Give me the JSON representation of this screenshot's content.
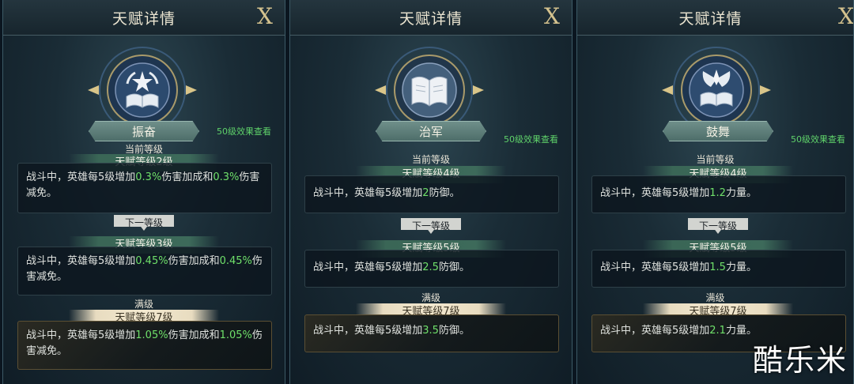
{
  "panels": [
    {
      "title": "天赋详情",
      "close": "X",
      "talent_name": "振奋",
      "effect_link": "50级效果查看",
      "current_label": "当前等级",
      "current_level": "天赋等级2级",
      "current_desc": {
        "pre": "战斗中，英雄每5级增加",
        "v1": "0.3%",
        "mid": "伤害加成和",
        "v2": "0.3%",
        "post": "伤害减免。"
      },
      "next_label": "下一等级",
      "next_level": "天赋等级3级",
      "next_desc": {
        "pre": "战斗中，英雄每5级增加",
        "v1": "0.45%",
        "mid": "伤害加成和",
        "v2": "0.45%",
        "post": "伤害减免。"
      },
      "max_label": "满级",
      "max_level": "天赋等级7级",
      "max_desc": {
        "pre": "战斗中，英雄每5级增加",
        "v1": "1.05%",
        "mid": "伤害加成和",
        "v2": "1.05%",
        "post": "伤害减免。"
      }
    },
    {
      "title": "天赋详情",
      "close": "X",
      "talent_name": "治军",
      "effect_link": "50级效果查看",
      "current_label": "当前等级",
      "current_level": "天赋等级4级",
      "current_desc": {
        "pre": "战斗中，英雄每5级增加",
        "v1": "2",
        "post": "防御。"
      },
      "next_label": "下一等级",
      "next_level": "天赋等级5级",
      "next_desc": {
        "pre": "战斗中，英雄每5级增加",
        "v1": "2.5",
        "post": "防御。"
      },
      "max_label": "满级",
      "max_level": "天赋等级7级",
      "max_desc": {
        "pre": "战斗中，英雄每5级增加",
        "v1": "3.5",
        "post": "防御。"
      }
    },
    {
      "title": "天赋详情",
      "close": "X",
      "talent_name": "鼓舞",
      "effect_link": "50级效果查看",
      "current_label": "当前等级",
      "current_level": "天赋等级4级",
      "current_desc": {
        "pre": "战斗中，英雄每5级增加",
        "v1": "1.2",
        "post": "力量。"
      },
      "next_label": "下一等级",
      "next_level": "天赋等级5级",
      "next_desc": {
        "pre": "战斗中，英雄每5级增加",
        "v1": "1.5",
        "post": "力量。"
      },
      "max_label": "满级",
      "max_level": "天赋等级7级",
      "max_desc": {
        "pre": "战斗中，英雄每5级增加",
        "v1": "2.1",
        "post": "力量。"
      }
    }
  ],
  "watermark": "酷乐米",
  "colors": {
    "highlight": "#6fe06a",
    "link": "#5fd26a",
    "gold": "#d4c28e"
  },
  "icons": [
    "book-star-icon",
    "open-book-icon",
    "winged-book-icon"
  ]
}
